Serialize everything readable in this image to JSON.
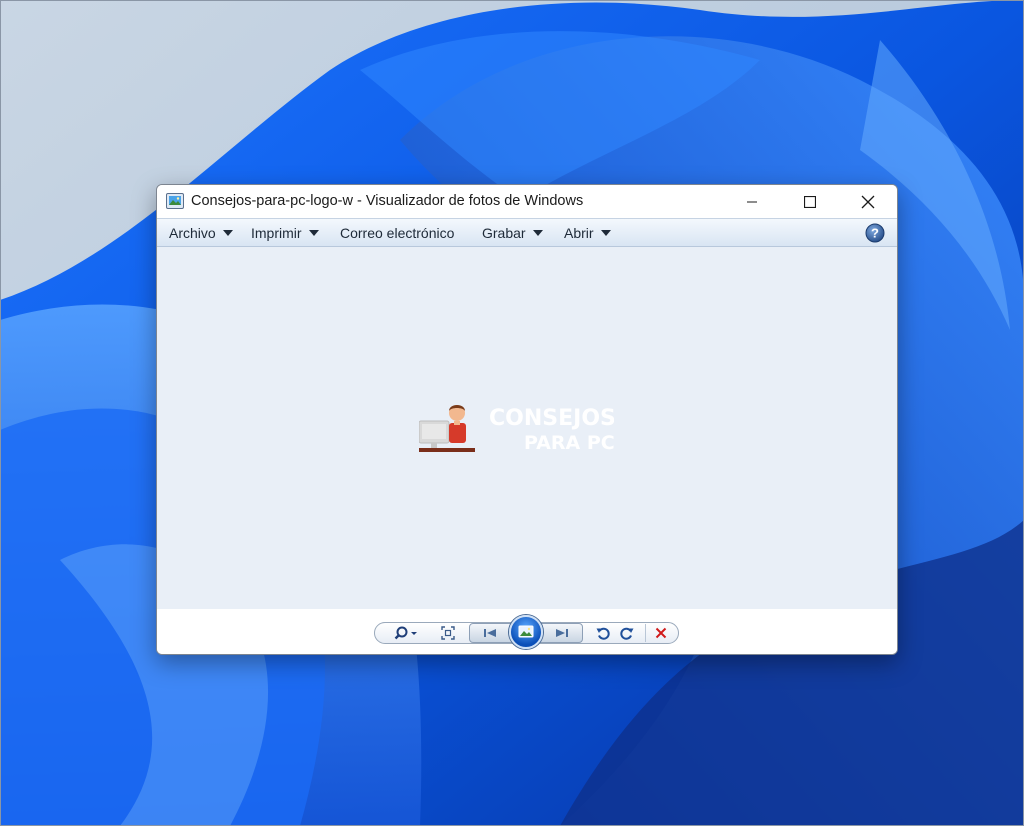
{
  "window": {
    "title": "Consejos-para-pc-logo-w - Visualizador de fotos de Windows",
    "icons": {
      "app": "photo-viewer-icon",
      "minimize": "minimize-icon",
      "maximize": "maximize-icon",
      "close": "close-icon"
    }
  },
  "menu": {
    "items": [
      {
        "label": "Archivo",
        "has_dropdown": true
      },
      {
        "label": "Imprimir",
        "has_dropdown": true
      },
      {
        "label": "Correo electrónico",
        "has_dropdown": false
      },
      {
        "label": "Grabar",
        "has_dropdown": true
      },
      {
        "label": "Abrir",
        "has_dropdown": true
      }
    ],
    "help_icon": "help-icon"
  },
  "image": {
    "logo_line1": "CONSEJOS",
    "logo_line2": "PARA PC"
  },
  "toolbar": {
    "buttons": [
      "zoom-icon",
      "actual-size-icon",
      "previous-icon",
      "slideshow-icon",
      "next-icon",
      "rotate-left-icon",
      "rotate-right-icon",
      "delete-icon"
    ]
  },
  "colors": {
    "viewer_bg": "#e9eff7",
    "menubar": "#dbe6f3",
    "accent": "#0b4fb8",
    "delete": "#d11a1a",
    "desktop_bloom": "#0a5ee8"
  }
}
